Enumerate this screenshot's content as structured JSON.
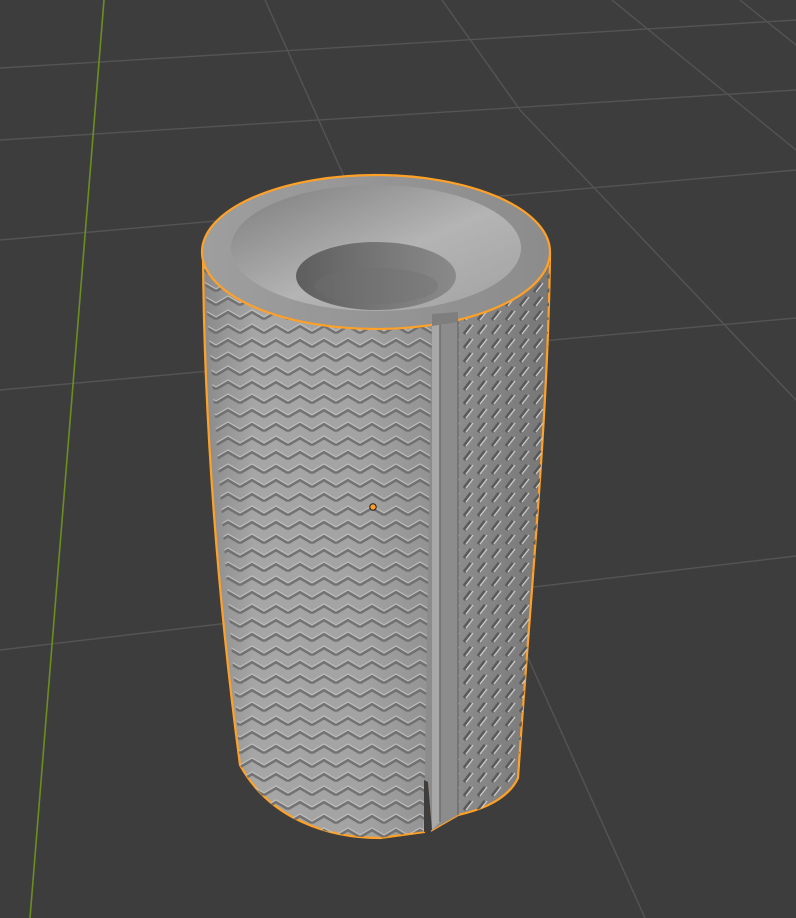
{
  "viewport": {
    "background_color": "#3d3d3d",
    "grid_line_color": "#545454",
    "axis_y_color": "#6b8f1e",
    "selection_outline_color": "#ffa126",
    "origin_color": "#ff9d2a"
  },
  "object": {
    "shape": "knurled-cylinder-sleeve",
    "selected": true,
    "features": [
      "conical-top-recess",
      "center-bore",
      "vertical-slot",
      "knurled-surface"
    ],
    "material_color": "#9a9a9a"
  }
}
